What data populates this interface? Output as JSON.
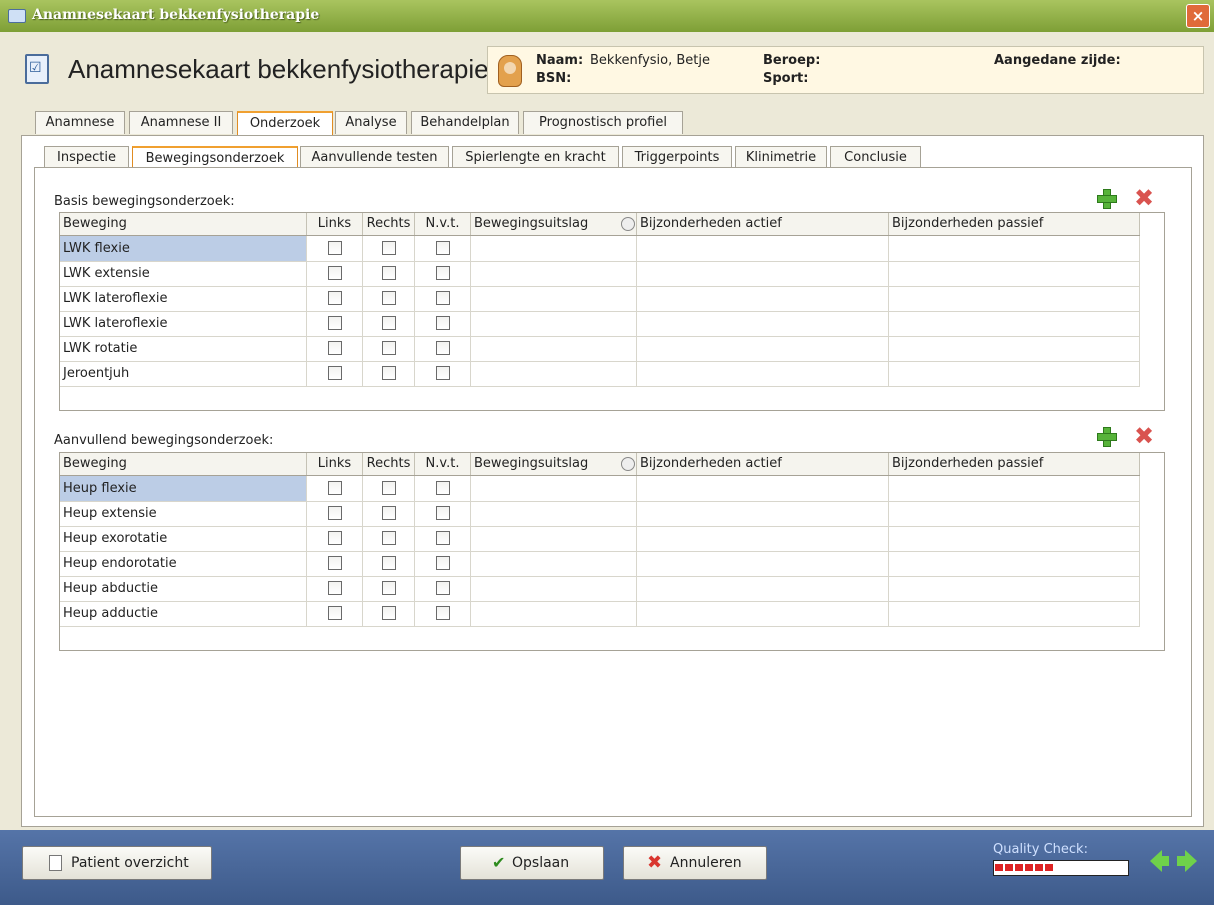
{
  "window": {
    "title": "Anamnesekaart bekkenfysiotherapie",
    "close_glyph": "×"
  },
  "header": {
    "title": "Anamnesekaart bekkenfysiotherapie",
    "naam_label": "Naam:",
    "naam_value": "Bekkenfysio, Betje",
    "bsn_label": "BSN:",
    "beroep_label": "Beroep:",
    "sport_label": "Sport:",
    "zijde_label": "Aangedane zijde:"
  },
  "tabs": [
    "Anamnese",
    "Anamnese II",
    "Onderzoek",
    "Analyse",
    "Behandelplan",
    "Prognostisch profiel"
  ],
  "active_tab": "Onderzoek",
  "subtabs": [
    "Inspectie",
    "Bewegingsonderzoek",
    "Aanvullende testen",
    "Spierlengte en kracht",
    "Triggerpoints",
    "Klinimetrie",
    "Conclusie"
  ],
  "active_subtab": "Bewegingsonderzoek",
  "columns": [
    "Beweging",
    "Links",
    "Rechts",
    "N.v.t.",
    "Bewegingsuitslag",
    "Bijzonderheden actief",
    "Bijzonderheden passief"
  ],
  "basis": {
    "label": "Basis bewegingsonderzoek:",
    "rows": [
      "LWK flexie",
      "LWK extensie",
      "LWK lateroflexie",
      "LWK lateroflexie",
      "LWK rotatie",
      "Jeroentjuh"
    ]
  },
  "aanvullend": {
    "label": "Aanvullend bewegingsonderzoek:",
    "rows": [
      "Heup flexie",
      "Heup extensie",
      "Heup exorotatie",
      "Heup endorotatie",
      "Heup abductie",
      "Heup adductie"
    ]
  },
  "footer": {
    "patient_button": "Patient overzicht",
    "save_button": "Opslaan",
    "cancel_button": "Annuleren",
    "quality_label": "Quality Check:",
    "quality_level": 0.45
  },
  "colors": {
    "accent_tab": "#f0a030",
    "titlebar": "#8fae45",
    "footer": "#3d5a8a",
    "selected_row": "#bccde6"
  }
}
